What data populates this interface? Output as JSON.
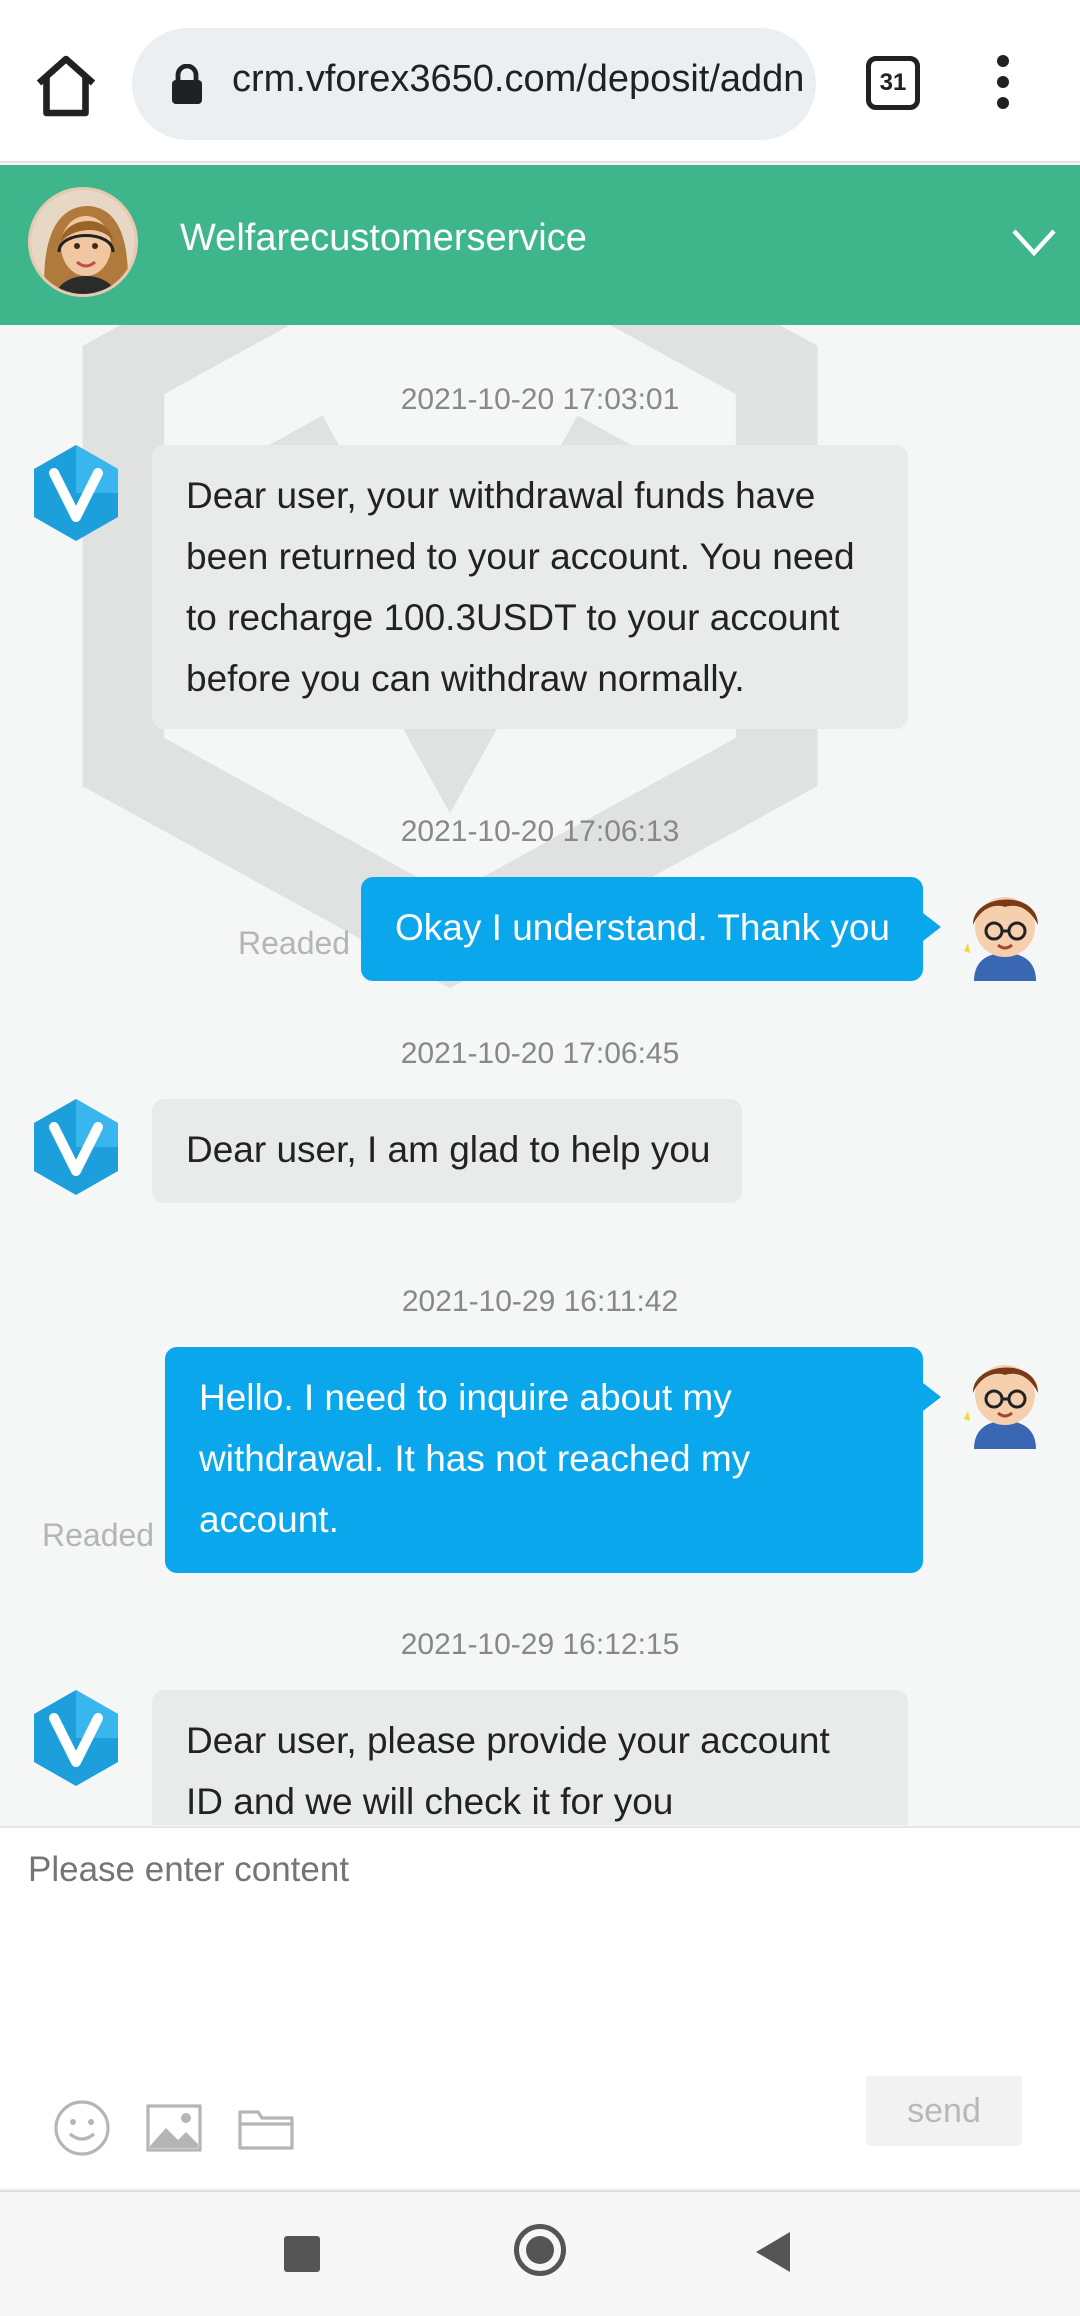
{
  "browser": {
    "url": "crm.vforex3650.com/deposit/addn",
    "tab_count": "31"
  },
  "header": {
    "agent_name": "Welfarecustomerservice"
  },
  "messages": [
    {
      "timestamp": "2021-10-20 17:03:01",
      "sender": "agent",
      "text": "Dear user, your withdrawal funds have been returned to your account. You need to recharge 100.3USDT to your account before you can withdraw normally."
    },
    {
      "timestamp": "2021-10-20 17:06:13",
      "sender": "user",
      "text": "Okay I understand. Thank you",
      "status": "Readed"
    },
    {
      "timestamp": "2021-10-20 17:06:45",
      "sender": "agent",
      "text": "Dear user, I am glad to help you"
    },
    {
      "timestamp": "2021-10-29 16:11:42",
      "sender": "user",
      "text": "Hello. I need to inquire about my withdrawal. It has not reached my account.",
      "status": "Readed"
    },
    {
      "timestamp": "2021-10-29 16:12:15",
      "sender": "agent",
      "text": "Dear user, please provide your account ID and we will check it for you"
    }
  ],
  "composer": {
    "placeholder": "Please enter content",
    "send_label": "send"
  },
  "colors": {
    "header_green": "#3fb58c",
    "user_bubble": "#0aa7ec",
    "agent_bubble": "#e9ebeb"
  }
}
